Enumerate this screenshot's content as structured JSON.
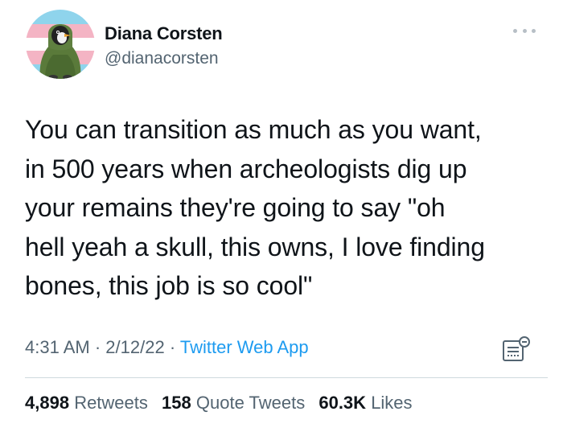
{
  "author": {
    "name": "Diana Corsten",
    "handle": "@dianacorsten"
  },
  "tweet": {
    "lines": [
      "You can transition as much as you want,",
      "in 500 years when archeologists dig up",
      "your remains they're going to say \"oh",
      "hell yeah a skull, this owns, I love finding",
      "bones, this job is so cool\""
    ],
    "time": "4:31 AM",
    "separator": "·",
    "date": "2/12/22",
    "source": "Twitter Web App"
  },
  "stats": {
    "retweets_count": "4,898",
    "retweets_label": "Retweets",
    "quotes_count": "158",
    "quotes_label": "Quote Tweets",
    "likes_count": "60.3K",
    "likes_label": "Likes"
  },
  "icons": {
    "more": "more-options-icon",
    "analytics": "analytics-icon"
  },
  "colors": {
    "text": "#0f1419",
    "secondary": "#536471",
    "link": "#1d9bf0",
    "divider": "#cfd9de",
    "avatar_flag_blue": "#8fd4ec",
    "avatar_flag_pink": "#f4b4c4",
    "avatar_hoodie": "#5a7a3a"
  }
}
